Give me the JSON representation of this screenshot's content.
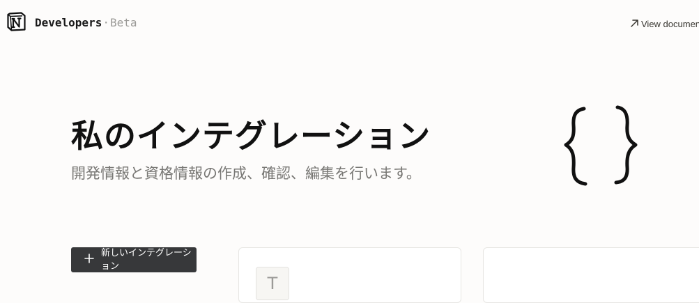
{
  "header": {
    "brand_name": "Developers",
    "brand_separator": "·",
    "brand_badge": "Beta",
    "logo_icon": "notion-logo-icon",
    "view_docs_label": "View documentation",
    "view_docs_icon": "arrow-up-right-icon"
  },
  "hero": {
    "title": "私のインテグレーション",
    "subtitle": "開発情報と資格情報の作成、確認、編集を行います。",
    "illustration_icon": "curly-braces-icon"
  },
  "actions": {
    "new_integration_label": "新しいインテグレーション",
    "new_integration_icon": "plus-icon"
  },
  "integrations": [
    {
      "avatar_initial": "T"
    },
    {
      "avatar_initial": ""
    }
  ],
  "colors": {
    "background": "#fdfcfb",
    "button_bg": "#37383a",
    "subtitle": "#787774",
    "card_border": "#e7e6e3"
  }
}
